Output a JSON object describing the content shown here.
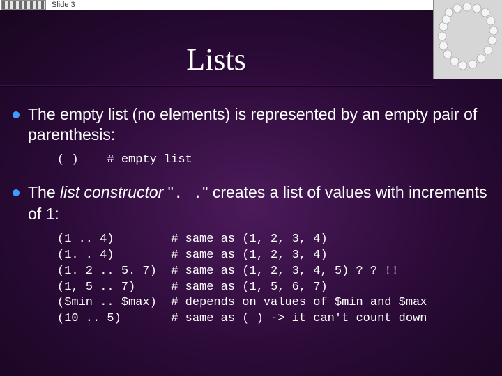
{
  "header": {
    "slide_label": "Slide 3",
    "logo_alt": "COMPAN logo",
    "decor_alt": "pearl necklace decoration"
  },
  "title": "Lists",
  "bullets": [
    {
      "pre": "The empty list (no elements) is represented by an empty pair of parenthesis:",
      "code": "( )    # empty list"
    },
    {
      "pre_parts": {
        "a": "The ",
        "b_italic": "list constructor",
        "c": " \"",
        "d_mono": ". .",
        "e": "\" creates a list of values with increments of 1:"
      },
      "code": "(1 .. 4)        # same as (1, 2, 3, 4)\n(1. . 4)        # same as (1, 2, 3, 4)\n(1. 2 .. 5. 7)  # same as (1, 2, 3, 4, 5) ? ? !!\n(1, 5 .. 7)     # same as (1, 5, 6, 7)\n($min .. $max)  # depends on values of $min and $max\n(10 .. 5)       # same as ( ) -> it can't count down"
    }
  ]
}
